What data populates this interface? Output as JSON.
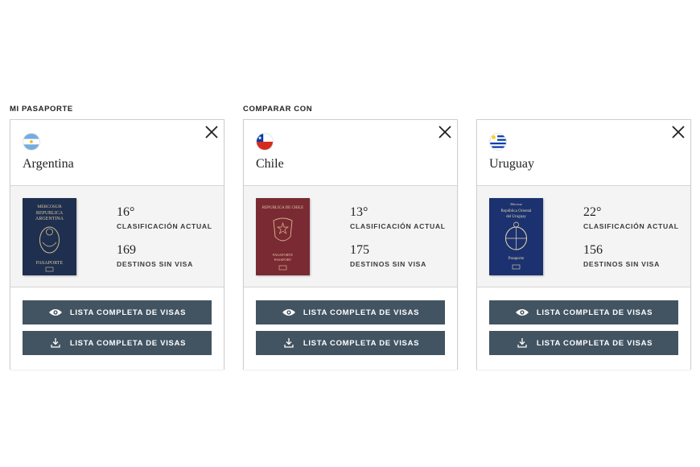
{
  "sections": {
    "mine_label": "MI PASAPORTE",
    "compare_label": "COMPARAR CON"
  },
  "cards": [
    {
      "country": "Argentina",
      "flag_icon": "argentina-flag-icon",
      "passport_lines": [
        "MERCOSUR",
        "REPUBLICA",
        "ARGENTINA",
        "PASAPORTE"
      ],
      "passport_color": "#1f2f4f",
      "rank": "16°",
      "rank_label": "CLASIFICACIÓN ACTUAL",
      "destinations": "169",
      "destinations_label": "DESTINOS SIN VISA",
      "view_button": "LISTA COMPLETA DE VISAS",
      "download_button": "LISTA COMPLETA DE VISAS"
    },
    {
      "country": "Chile",
      "flag_icon": "chile-flag-icon",
      "passport_lines": [
        "REPUBLICA DE CHILE",
        "PASAPORTE",
        "PASSPORT"
      ],
      "passport_color": "#7a2a33",
      "rank": "13°",
      "rank_label": "CLASIFICACIÓN ACTUAL",
      "destinations": "175",
      "destinations_label": "DESTINOS SIN VISA",
      "view_button": "LISTA COMPLETA DE VISAS",
      "download_button": "LISTA COMPLETA DE VISAS"
    },
    {
      "country": "Uruguay",
      "flag_icon": "uruguay-flag-icon",
      "passport_lines": [
        "Mercosur",
        "República Oriental",
        "del Uruguay",
        "Pasaporte"
      ],
      "passport_color": "#1c3270",
      "rank": "22°",
      "rank_label": "CLASIFICACIÓN ACTUAL",
      "destinations": "156",
      "destinations_label": "DESTINOS SIN VISA",
      "view_button": "LISTA COMPLETA DE VISAS",
      "download_button": "LISTA COMPLETA DE VISAS"
    }
  ],
  "colors": {
    "button_bg": "#425462",
    "body_bg": "#f4f4f4"
  }
}
